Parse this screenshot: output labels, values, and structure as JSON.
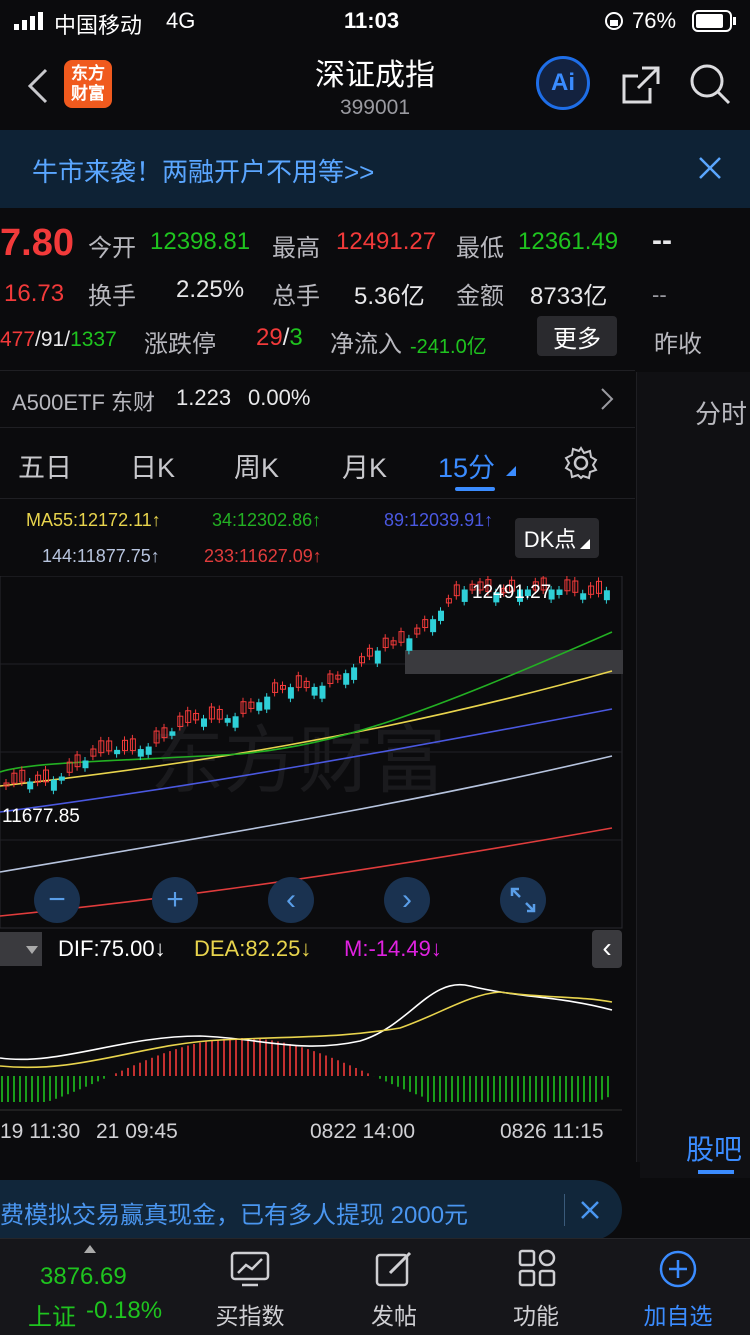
{
  "status": {
    "carrier": "中国移动",
    "network": "4G",
    "time": "11:03",
    "battery": "76%"
  },
  "nav": {
    "logo_line1": "东方",
    "logo_line2": "财富",
    "title": "深证成指",
    "code": "399001",
    "ai": "Ai"
  },
  "banner": {
    "text": "牛市来袭！两融开户不用等>>"
  },
  "quote": {
    "price": "7.80",
    "change": "16.73",
    "updown_a": "477",
    "updown_b": "/91/",
    "updown_c": "1337",
    "open_label": "今开",
    "open": "12398.81",
    "high_label": "最高",
    "high": "12491.27",
    "low_label": "最低",
    "low": "12361.49",
    "turnover_label": "换手",
    "turnover": "2.25%",
    "volume_label": "总手",
    "volume": "5.36亿",
    "amount_label": "金额",
    "amount": "8733亿",
    "limit_label": "涨跌停",
    "limit_up": "29",
    "limit_sep": "/",
    "limit_down": "3",
    "netflow_label": "净流入",
    "netflow": "-241.0亿",
    "more": "更多",
    "side_dash1": "--",
    "side_dash2": "--",
    "prev_close": "昨收"
  },
  "etf": {
    "name": "A500ETF 东财",
    "price": "1.223",
    "pct": "0.00%"
  },
  "side": {
    "fenshi": "分时",
    "guba": "股吧"
  },
  "tabs": [
    "五日",
    "日K",
    "周K",
    "月K",
    "15分"
  ],
  "ma": {
    "ma55": "MA55:12172.11↑",
    "ma34": "34:12302.86↑",
    "ma89": "89:12039.91↑",
    "ma144": "144:11877.75↑",
    "ma233": "233:11627.09↑",
    "dk": "DK点"
  },
  "chart_labels": {
    "high": "12491.27",
    "low": "11677.85"
  },
  "macd": {
    "dif": "DIF:75.00↓",
    "dea": "DEA:82.25↓",
    "m": "M:-14.49↓"
  },
  "axis": [
    "19 11:30",
    "21 09:45",
    "0822 14:00",
    "0826 11:15"
  ],
  "promo": {
    "text": "费模拟交易赢真现金，已有多人提现 2000元"
  },
  "bottom": {
    "index_value": "3876.69",
    "index_name": "上证",
    "index_pct": "-0.18%",
    "items": [
      "买指数",
      "发帖",
      "功能",
      "加自选"
    ]
  },
  "colors": {
    "up": "#f23a3a",
    "down": "#1fc41f",
    "accent": "#3b8cff",
    "cyan": "#2fd0d8"
  }
}
